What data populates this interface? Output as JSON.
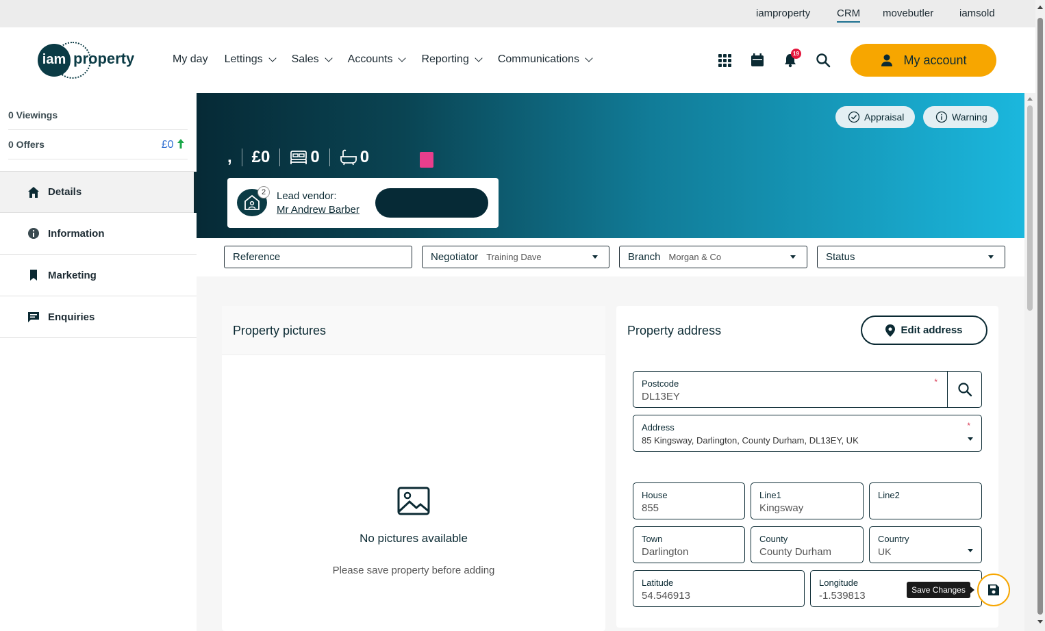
{
  "top_links": [
    {
      "label": "iamproperty"
    },
    {
      "label": "CRM"
    },
    {
      "label": "movebutler"
    },
    {
      "label": "iamsold"
    }
  ],
  "logo": {
    "mark": "iam",
    "word": "property"
  },
  "nav": [
    {
      "label": "My day"
    },
    {
      "label": "Lettings"
    },
    {
      "label": "Sales"
    },
    {
      "label": "Accounts"
    },
    {
      "label": "Reporting"
    },
    {
      "label": "Communications"
    }
  ],
  "header": {
    "notification_count": "19",
    "my_account_label": "My account"
  },
  "sidebar": {
    "viewings": "0 Viewings",
    "offers": "0 Offers",
    "offers_amount": "£0",
    "menu": [
      {
        "label": "Details"
      },
      {
        "label": "Information"
      },
      {
        "label": "Marketing"
      },
      {
        "label": "Enquiries"
      }
    ]
  },
  "banner": {
    "appraisal_label": "Appraisal",
    "warning_label": "Warning",
    "address_short": ",",
    "price": "£0",
    "bedrooms": "0",
    "bathrooms": "0",
    "status_color": "#e83e8c",
    "vendor_count": "2",
    "lead_vendor_label": "Lead vendor:",
    "lead_vendor_name": "Mr Andrew Barber"
  },
  "filters": {
    "reference_label": "Reference",
    "negotiator_label": "Negotiator",
    "negotiator_value": "Training Dave",
    "branch_label": "Branch",
    "branch_value": "Morgan & Co",
    "status_label": "Status"
  },
  "pictures": {
    "title": "Property pictures",
    "empty_title": "No pictures available",
    "empty_hint": "Please save property before adding"
  },
  "address": {
    "title": "Property address",
    "edit_label": "Edit address",
    "postcode_label": "Postcode",
    "postcode_value": "DL13EY",
    "address_label": "Address",
    "address_value": "85 Kingsway, Darlington, County Durham, DL13EY, UK",
    "house_label": "House",
    "house_value": "855",
    "line1_label": "Line1",
    "line1_value": "Kingsway",
    "line2_label": "Line2",
    "line2_value": "",
    "town_label": "Town",
    "town_value": "Darlington",
    "county_label": "County",
    "county_value": "County Durham",
    "country_label": "Country",
    "country_value": "UK",
    "latitude_label": "Latitude",
    "latitude_value": "54.546913",
    "longitude_label": "Longitude",
    "longitude_value": "-1.539813"
  },
  "save_tooltip": "Save Changes",
  "colors": {
    "accent": "#f7a600",
    "brand": "#0b3b45",
    "required": "#d8344f"
  }
}
